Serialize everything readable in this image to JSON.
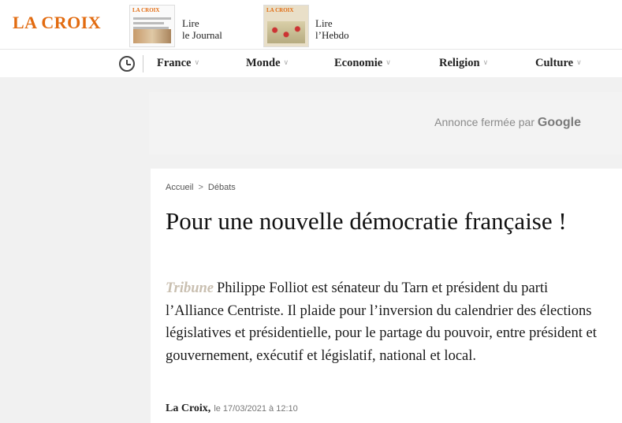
{
  "header": {
    "logo": "LA CROIX",
    "journal": {
      "masthead": "LA CROIX",
      "label_line1": "Lire",
      "label_line2": "le Journal"
    },
    "hebdo": {
      "masthead": "LA CROIX",
      "label_line1": "Lire",
      "label_line2": "l’Hebdo"
    },
    "brand_color": "#e26b10"
  },
  "nav": {
    "history_icon": "clock-icon",
    "items": [
      {
        "label": "France"
      },
      {
        "label": "Monde"
      },
      {
        "label": "Economie"
      },
      {
        "label": "Religion"
      },
      {
        "label": "Culture"
      }
    ],
    "chevron": "∨"
  },
  "ad": {
    "text": "Annonce fermée par",
    "brand": "Google"
  },
  "article": {
    "breadcrumb": {
      "home": "Accueil",
      "separator": ">",
      "section": "Débats"
    },
    "title": "Pour une nouvelle démocratie française !",
    "kicker": "Tribune",
    "chapo": "Philippe Folliot est sénateur du Tarn et président du parti l’Alliance Centriste. Il plaide pour l’inversion du calendrier des élections législatives et présidentielle, pour le partage du pouvoir, entre président et gouvernement, exécutif et législatif, national et local.",
    "author": "La Croix,",
    "date": "le 17/03/2021 à 12:10"
  }
}
